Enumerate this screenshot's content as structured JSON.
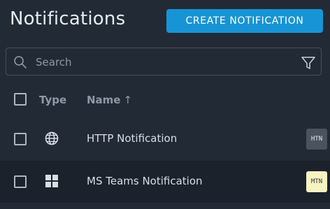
{
  "page": {
    "title": "Notifications"
  },
  "toolbar": {
    "create_label": "CREATE NOTIFICATION"
  },
  "search": {
    "placeholder": "Search",
    "value": ""
  },
  "table": {
    "columns": {
      "type": "Type",
      "name": "Name",
      "sort_indicator": "↑"
    },
    "rows": [
      {
        "type_icon": "globe-icon",
        "name": "HTTP Notification",
        "badge": "HTN",
        "badge_bg": "#4b535e",
        "badge_fg": "#e6ebf1"
      },
      {
        "type_icon": "windows-icon",
        "name": "MS Teams Notification",
        "badge": "MTN",
        "badge_bg": "#f7f4c2",
        "badge_fg": "#333333"
      }
    ]
  },
  "colors": {
    "accent": "#1794d5",
    "background": "#222a36",
    "row_alt": "#1b222c"
  }
}
